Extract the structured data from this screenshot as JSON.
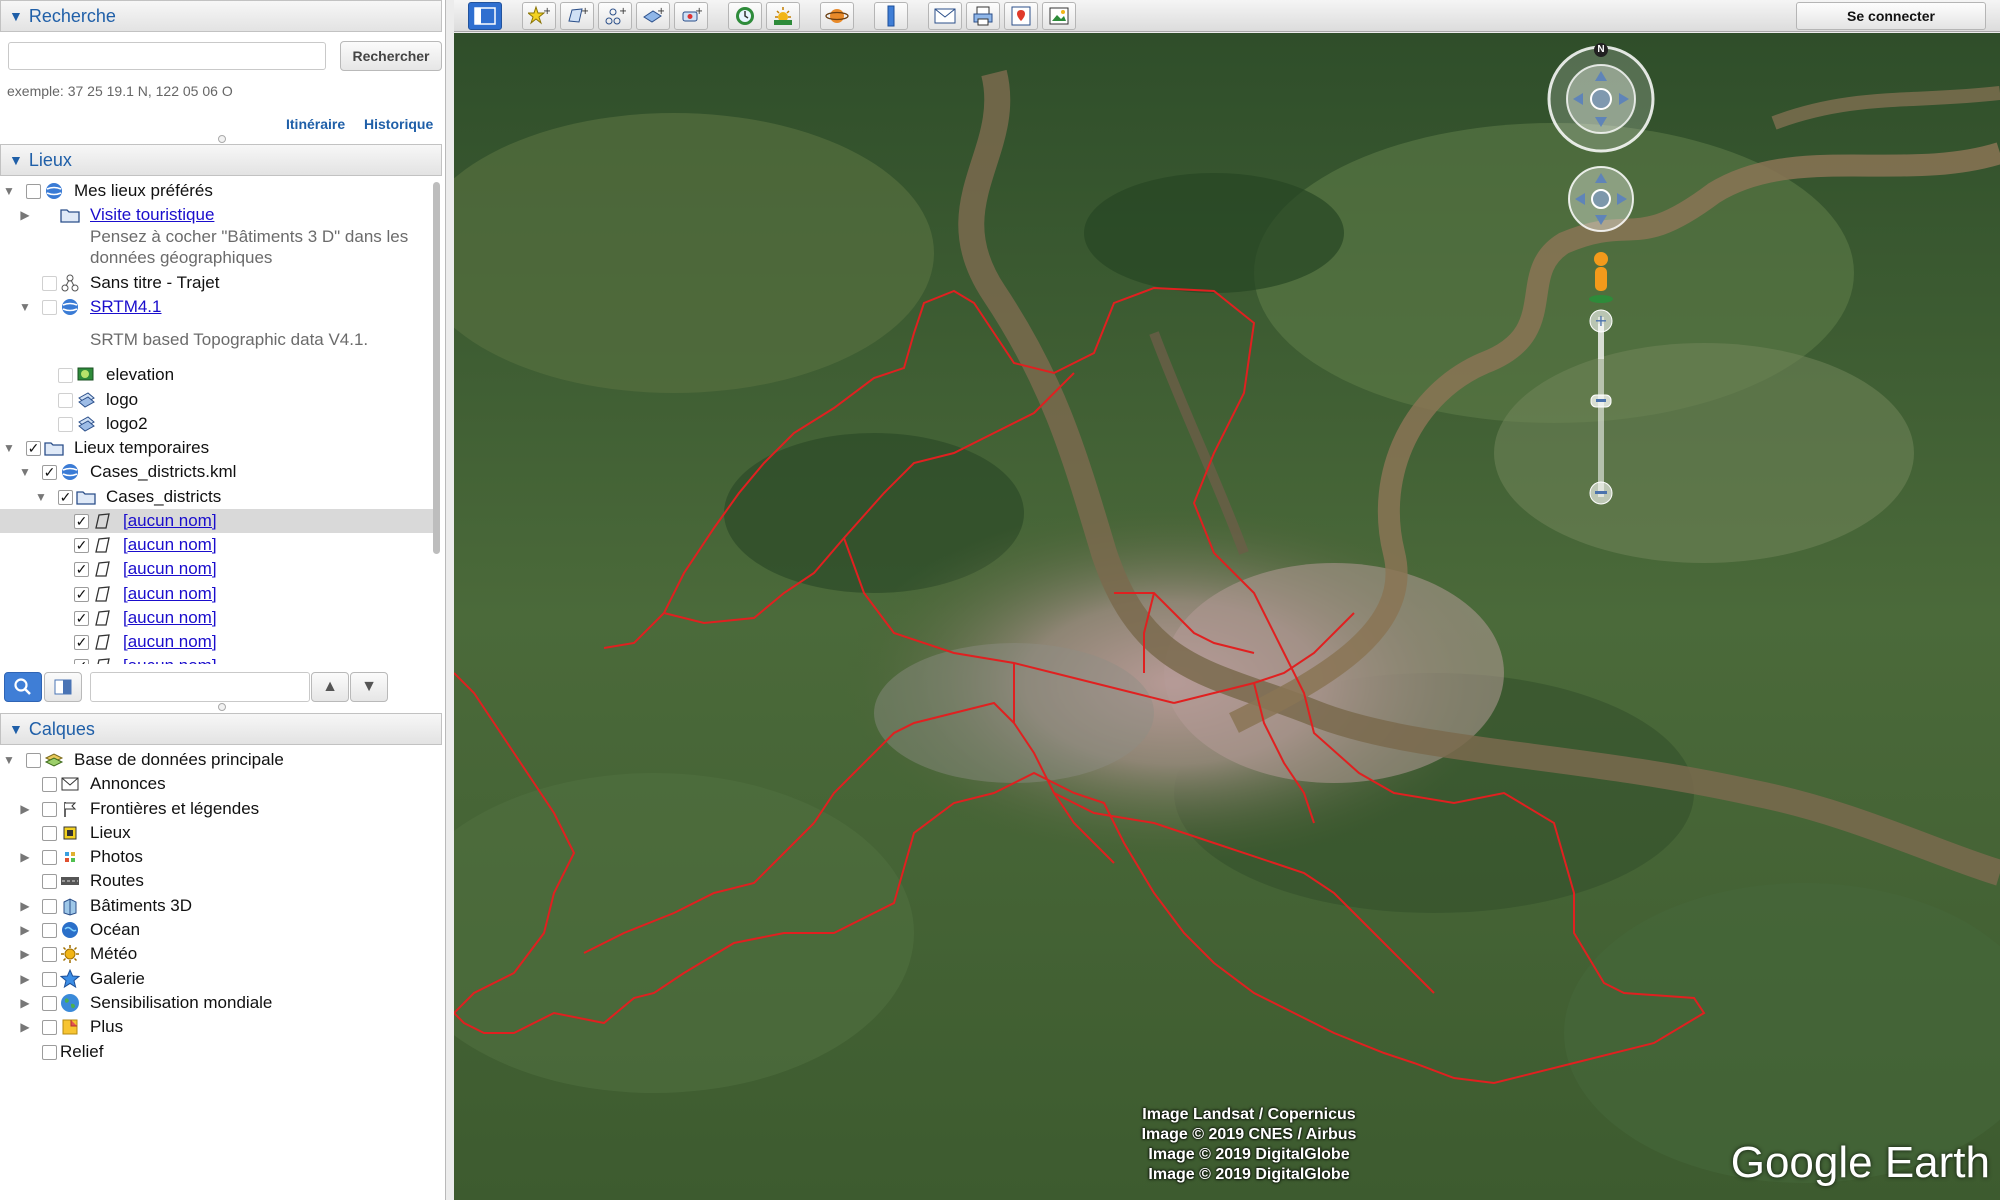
{
  "search": {
    "header": "Recherche",
    "button": "Rechercher",
    "example": "exemple: 37 25 19.1 N, 122 05 06 O",
    "links": [
      "Itinéraire",
      "Historique"
    ]
  },
  "places": {
    "header": "Lieux",
    "items": [
      {
        "label": "Mes lieux préférés"
      },
      {
        "label": "Visite touristique",
        "desc1": "Pensez à cocher \"Bâtiments 3 D\" dans les",
        "desc2": "données géographiques"
      },
      {
        "label": "Sans titre - Trajet"
      },
      {
        "label": "SRTM4.1",
        "desc": "SRTM based Topographic data V4.1."
      },
      {
        "label": "elevation"
      },
      {
        "label": "logo"
      },
      {
        "label": "logo2"
      },
      {
        "label": "Lieux temporaires"
      },
      {
        "label": "Cases_districts.kml"
      },
      {
        "label": "Cases_districts"
      },
      {
        "label": "[aucun nom]"
      },
      {
        "label": "[aucun nom]"
      },
      {
        "label": "[aucun nom]"
      },
      {
        "label": "[aucun nom]"
      },
      {
        "label": "[aucun nom]"
      },
      {
        "label": "[aucun nom]"
      },
      {
        "label": "[aucun nom]"
      }
    ]
  },
  "layers": {
    "header": "Calques",
    "items": [
      {
        "label": "Base de données principale",
        "icon": "database-icon"
      },
      {
        "label": "Annonces",
        "icon": "envelope-icon"
      },
      {
        "label": "Frontières et légendes",
        "icon": "flag-icon"
      },
      {
        "label": "Lieux",
        "icon": "place-icon"
      },
      {
        "label": "Photos",
        "icon": "photo-icon"
      },
      {
        "label": "Routes",
        "icon": "road-icon"
      },
      {
        "label": "Bâtiments 3D",
        "icon": "building-icon"
      },
      {
        "label": "Océan",
        "icon": "ocean-icon"
      },
      {
        "label": "Météo",
        "icon": "weather-icon"
      },
      {
        "label": "Galerie",
        "icon": "star-icon"
      },
      {
        "label": "Sensibilisation mondiale",
        "icon": "globe-icon"
      },
      {
        "label": "Plus",
        "icon": "more-icon"
      },
      {
        "label": "Relief",
        "icon": ""
      }
    ]
  },
  "toolbar": {
    "connect": "Se connecter",
    "tools": [
      "sidebar-toggle-icon",
      "placemark-icon",
      "polygon-icon",
      "path-icon",
      "image-overlay-icon",
      "record-tour-icon",
      "historical-imagery-icon",
      "sunlight-icon",
      "planets-icon",
      "ruler-icon",
      "email-icon",
      "print-icon",
      "google-maps-icon",
      "save-image-icon"
    ]
  },
  "map": {
    "compass_letter": "N",
    "attribution": [
      "Image Landsat / Copernicus",
      "Image © 2019 CNES / Airbus",
      "Image © 2019 DigitalGlobe",
      "Image © 2019 DigitalGlobe"
    ],
    "brand": "Google Earth",
    "boundary_color": "#e02020"
  }
}
